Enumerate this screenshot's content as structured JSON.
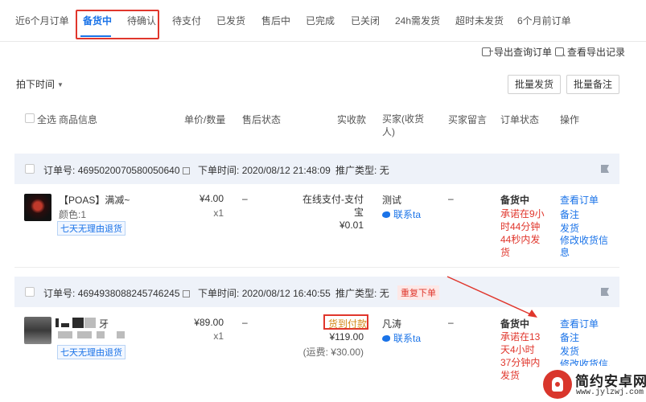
{
  "tabs": [
    {
      "label": "近6个月订单",
      "active": false
    },
    {
      "label": "备货中",
      "active": true
    },
    {
      "label": "待确认",
      "active": false
    },
    {
      "label": "待支付",
      "active": false
    },
    {
      "label": "已发货",
      "active": false
    },
    {
      "label": "售后中",
      "active": false
    },
    {
      "label": "已完成",
      "active": false
    },
    {
      "label": "已关闭",
      "active": false
    },
    {
      "label": "24h需发货",
      "active": false
    },
    {
      "label": "超时未发货",
      "active": false
    },
    {
      "label": "6个月前订单",
      "active": false
    }
  ],
  "toolbar": {
    "export_query": "导出查询订单",
    "view_export": "查看导出记录",
    "sort_label": "拍下时间",
    "batch_ship": "批量发货",
    "batch_note": "批量备注"
  },
  "columns": {
    "select_all": "全选",
    "product_info": "商品信息",
    "price_qty": "单价/数量",
    "after_sale": "售后状态",
    "paid": "实收款",
    "buyer": "买家(收货人)",
    "buyer_msg": "买家留言",
    "order_status": "订单状态",
    "actions": "操作"
  },
  "orders": [
    {
      "order_no_label": "订单号:",
      "order_no": "4695020070580050640",
      "time_label": "下单时间:",
      "time": "2020/08/12 21:48:09",
      "promo_label": "推广类型:",
      "promo": "无",
      "product_title": "【POAS】满减~",
      "product_variant": "颜色:1",
      "return_badge": "七天无理由退货",
      "price": "¥4.00",
      "qty": "x1",
      "after_sale": "–",
      "pay_method": "在线支付-支付宝",
      "amount": "¥0.01",
      "buyer": "测试",
      "contact": "联系ta",
      "buyer_msg": "–",
      "status": "备货中",
      "promise": "承诺在9小时44分钟44秒内发货",
      "actions": [
        "查看订单",
        "备注",
        "发货",
        "修改收货信息"
      ]
    },
    {
      "order_no_label": "订单号:",
      "order_no": "4694938088245746245",
      "time_label": "下单时间:",
      "time": "2020/08/12 16:40:55",
      "promo_label": "推广类型:",
      "promo": "无",
      "repeat_tag": "重复下单",
      "product_title_tail": "牙",
      "return_badge": "七天无理由退货",
      "price": "¥89.00",
      "qty": "x1",
      "after_sale": "–",
      "pay_method": "货到付款",
      "amount": "¥119.00",
      "shipping": "(运费: ¥30.00)",
      "buyer": "凡涛",
      "contact": "联系ta",
      "buyer_msg": "–",
      "status": "备货中",
      "promise": "承诺在13天4小时37分钟内发货",
      "actions": [
        "查看订单",
        "备注",
        "发货",
        "修改收货信息"
      ]
    }
  ],
  "watermark": {
    "title": "简约安卓网",
    "url": "www.jylzwj.com"
  },
  "colors": {
    "accent": "#1a73e8",
    "alert": "#e0362c",
    "header_bg": "#eef2f9"
  }
}
